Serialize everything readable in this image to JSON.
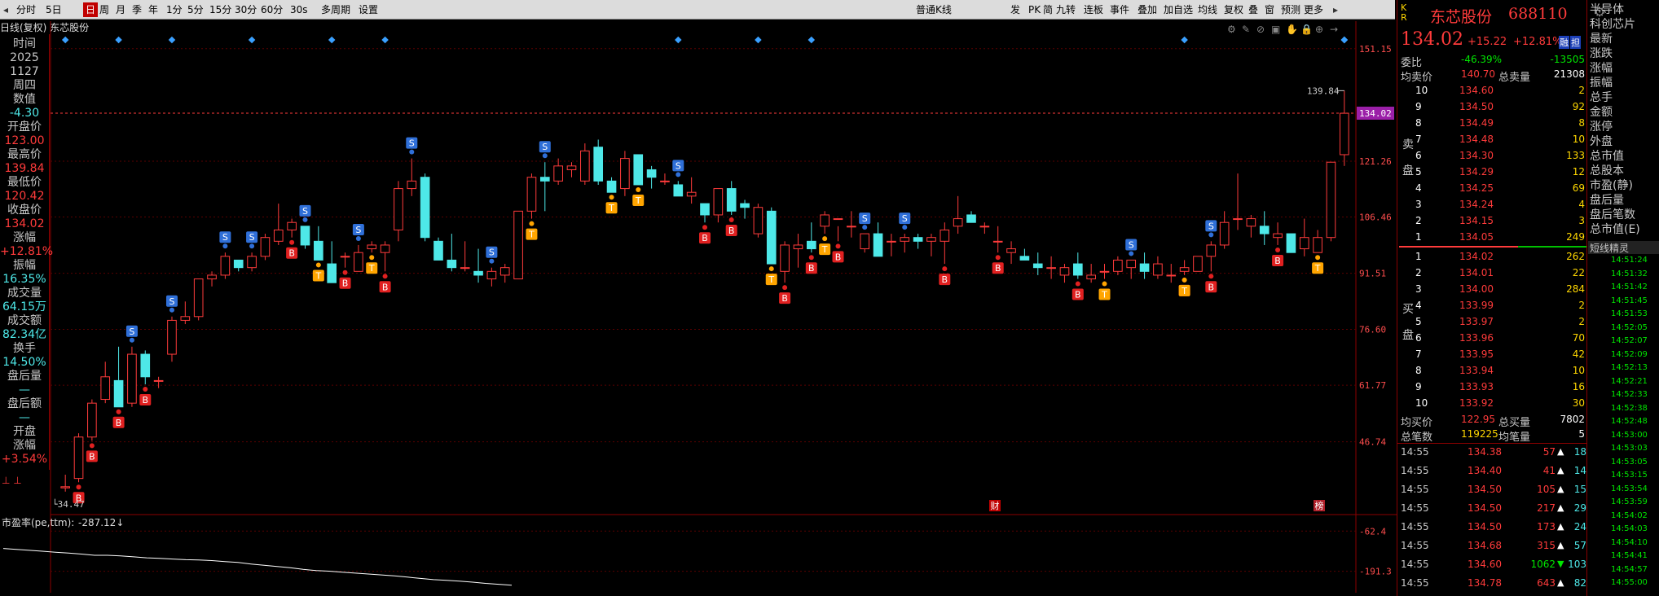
{
  "toolbar": {
    "items": [
      "分时",
      "5日",
      "日",
      "周",
      "月",
      "季",
      "年",
      "1分",
      "5分",
      "15分",
      "30分",
      "60分",
      "30s",
      "多周期",
      "设置"
    ],
    "selected": "日",
    "right_items": [
      "普通K线",
      "发",
      "PK",
      "简",
      "九转",
      "连板",
      "事件",
      "叠加",
      "加自选",
      "均线",
      "复权",
      "叠",
      "窗",
      "预测",
      "更多"
    ]
  },
  "chart_title": "日线(复权)  东芯股份",
  "left_panel": [
    {
      "label": "时间",
      "value": "2025"
    },
    {
      "label": "",
      "value": "1127"
    },
    {
      "label": "周四",
      "value": ""
    },
    {
      "label": "数值",
      "value": "-4.30"
    },
    {
      "label": "开盘价",
      "value": "123.00"
    },
    {
      "label": "最高价",
      "value": "139.84"
    },
    {
      "label": "最低价",
      "value": "120.42"
    },
    {
      "label": "收盘价",
      "value": "134.02"
    },
    {
      "label": "涨幅",
      "value": "+12.81%"
    },
    {
      "label": "振幅",
      "value": "16.35%"
    },
    {
      "label": "成交量",
      "value": "64.15万"
    },
    {
      "label": "成交额",
      "value": "82.34亿"
    },
    {
      "label": "换手",
      "value": "14.50%"
    },
    {
      "label": "盘后量",
      "value": "—"
    },
    {
      "label": "盘后额",
      "value": "—"
    },
    {
      "label": "开盘",
      "value": ""
    },
    {
      "label": "涨幅",
      "value": "+3.54%"
    }
  ],
  "price_axis": [
    "151.15",
    "134.02",
    "121.26",
    "106.46",
    "91.51",
    "76.60",
    "61.77",
    "46.74"
  ],
  "max_label": "139.84",
  "min_label": "34.47",
  "current_price_tag": "134.02",
  "bottom_markers": [
    "财",
    "榜"
  ],
  "indicator": {
    "name": "市盈率(pe,ttm):",
    "value": "-287.12↓",
    "axis": [
      "-62.4",
      "-191.3"
    ]
  },
  "chart_data": {
    "type": "candlestick",
    "title": "日线(复权) 东芯股份",
    "candles": [
      [
        34.5,
        38,
        33.5,
        34.8
      ],
      [
        37,
        49,
        36,
        48
      ],
      [
        48,
        58,
        47,
        57
      ],
      [
        58,
        68,
        57,
        64
      ],
      [
        63,
        72,
        56,
        56
      ],
      [
        57,
        72,
        56,
        70
      ],
      [
        70,
        71,
        62,
        64
      ],
      [
        63,
        64,
        61,
        63
      ],
      [
        70,
        80,
        68,
        79
      ],
      [
        79,
        84,
        78,
        80
      ],
      [
        80,
        90,
        79,
        90
      ],
      [
        90,
        92,
        88,
        91
      ],
      [
        91,
        97,
        90,
        96
      ],
      [
        95,
        95,
        92,
        93
      ],
      [
        93,
        97,
        92,
        96
      ],
      [
        96,
        102,
        95,
        101
      ],
      [
        100,
        110,
        99,
        103
      ],
      [
        103,
        106,
        101,
        105
      ],
      [
        104,
        104,
        98,
        99
      ],
      [
        100,
        104,
        95,
        95
      ],
      [
        94,
        100,
        89,
        89
      ],
      [
        96,
        97,
        93,
        96
      ],
      [
        92,
        99,
        92,
        97
      ],
      [
        98,
        100,
        97,
        99
      ],
      [
        97,
        100,
        92,
        99
      ],
      [
        103,
        116,
        100,
        114
      ],
      [
        114,
        122,
        112,
        116
      ],
      [
        117,
        118,
        100,
        101
      ],
      [
        100,
        101,
        95,
        95
      ],
      [
        95,
        102,
        92,
        93
      ],
      [
        93,
        100,
        92,
        93
      ],
      [
        92,
        98,
        89,
        91
      ],
      [
        90,
        93,
        88,
        92
      ],
      [
        91,
        94,
        89,
        93
      ],
      [
        90,
        107,
        90,
        108
      ],
      [
        108,
        118,
        106,
        117
      ],
      [
        117,
        121,
        108,
        116
      ],
      [
        116,
        122,
        115,
        120
      ],
      [
        119,
        121,
        117,
        120
      ],
      [
        116,
        126,
        115,
        124
      ],
      [
        125,
        127,
        115,
        116
      ],
      [
        116,
        117,
        113,
        113
      ],
      [
        114,
        124,
        112,
        122
      ],
      [
        123,
        122,
        115,
        115
      ],
      [
        119,
        120,
        114,
        117
      ],
      [
        116,
        118,
        115,
        116
      ],
      [
        115,
        116,
        112,
        112
      ],
      [
        112,
        117,
        110,
        113
      ],
      [
        110,
        109,
        105,
        107
      ],
      [
        107,
        113,
        105,
        114
      ],
      [
        114,
        116,
        107,
        108
      ],
      [
        110,
        111,
        106,
        109
      ],
      [
        102,
        110,
        101,
        109
      ],
      [
        108,
        109,
        94,
        94
      ],
      [
        92,
        100,
        89,
        99
      ],
      [
        98,
        102,
        93,
        99
      ],
      [
        100,
        105,
        97,
        98
      ],
      [
        104,
        108,
        102,
        107
      ],
      [
        106,
        104,
        100,
        106
      ],
      [
        104,
        108,
        101,
        104
      ],
      [
        98,
        102,
        97,
        102
      ],
      [
        102,
        105,
        96,
        96
      ],
      [
        100,
        102,
        96,
        100
      ],
      [
        100,
        102,
        97,
        101
      ],
      [
        101,
        102,
        98,
        100
      ],
      [
        100,
        102,
        96,
        101
      ],
      [
        100,
        105,
        94,
        103
      ],
      [
        104,
        112,
        102,
        106
      ],
      [
        107,
        108,
        105,
        105
      ],
      [
        104,
        105,
        102,
        104
      ],
      [
        100,
        104,
        97,
        100
      ],
      [
        97,
        100,
        94,
        98
      ],
      [
        96,
        98,
        95,
        95
      ],
      [
        94,
        97,
        91,
        93
      ],
      [
        93,
        96,
        90,
        93
      ],
      [
        91,
        94,
        89,
        93
      ],
      [
        94,
        97,
        90,
        91
      ],
      [
        90,
        94,
        89,
        91
      ],
      [
        92,
        94,
        90,
        92
      ],
      [
        92,
        96,
        91,
        95
      ],
      [
        93,
        95,
        90,
        95
      ],
      [
        94,
        97,
        90,
        92
      ],
      [
        91,
        96,
        90,
        94
      ],
      [
        91,
        94,
        89,
        91
      ],
      [
        92,
        95,
        91,
        93
      ],
      [
        92,
        95,
        92,
        96
      ],
      [
        96,
        100,
        92,
        99
      ],
      [
        99,
        108,
        98,
        105
      ],
      [
        106,
        118,
        103,
        106
      ],
      [
        104,
        107,
        101,
        106
      ],
      [
        104,
        108,
        99,
        102
      ],
      [
        101,
        105,
        99,
        102
      ],
      [
        102,
        101,
        97,
        97
      ],
      [
        98,
        106,
        96,
        101
      ],
      [
        97,
        103,
        97,
        101
      ],
      [
        101,
        120,
        100,
        121
      ],
      [
        123,
        140,
        120,
        134
      ]
    ],
    "price_ylim": [
      30.0,
      155.0
    ],
    "indicator_series": [
      -118,
      -121,
      -124,
      -127,
      -130,
      -133,
      -136,
      -140,
      -140,
      -142,
      -145,
      -148,
      -150,
      -152,
      -154,
      -155,
      -157,
      -160,
      -163,
      -168,
      -172,
      -176,
      -180,
      -185,
      -189,
      -191,
      -194,
      -197,
      -200,
      -203,
      -206,
      -210,
      -214,
      -218,
      -220,
      -223,
      -226,
      -230,
      -233,
      -236
    ],
    "indicator_ylim": [
      -260,
      -20
    ]
  },
  "right": {
    "sector_tag": "K\nR",
    "name": "东芯股份",
    "code": "688110",
    "price": "134.02",
    "change": "+15.22",
    "change_pct": "+12.81%",
    "badges": [
      "融",
      "担"
    ],
    "weibi": {
      "label": "委比",
      "pct": "-46.39%",
      "diff": "-13505"
    },
    "avg_sell": {
      "label": "均卖价",
      "value": "140.70",
      "total_label": "总卖量",
      "total": "21308"
    },
    "side_sell": "卖\n\n盘",
    "side_buy": "买\n\n盘",
    "sell": [
      [
        "10",
        "134.60",
        "2"
      ],
      [
        "9",
        "134.50",
        "92"
      ],
      [
        "8",
        "134.49",
        "8"
      ],
      [
        "7",
        "134.48",
        "10"
      ],
      [
        "6",
        "134.30",
        "133"
      ],
      [
        "5",
        "134.29",
        "12"
      ],
      [
        "4",
        "134.25",
        "69"
      ],
      [
        "3",
        "134.24",
        "4"
      ],
      [
        "2",
        "134.15",
        "3"
      ],
      [
        "1",
        "134.05",
        "249"
      ]
    ],
    "buy": [
      [
        "1",
        "134.02",
        "262"
      ],
      [
        "2",
        "134.01",
        "22"
      ],
      [
        "3",
        "134.00",
        "284"
      ],
      [
        "4",
        "133.99",
        "2"
      ],
      [
        "5",
        "133.97",
        "2"
      ],
      [
        "6",
        "133.96",
        "70"
      ],
      [
        "7",
        "133.95",
        "42"
      ],
      [
        "8",
        "133.94",
        "10"
      ],
      [
        "9",
        "133.93",
        "16"
      ],
      [
        "10",
        "133.92",
        "30"
      ]
    ],
    "avg_buy": {
      "label": "均买价",
      "value": "122.95",
      "total_label": "总买量",
      "total": "7802"
    },
    "count": {
      "label": "总笔数",
      "value": "119225",
      "avg_label": "均笔量",
      "avg": "5"
    },
    "ticks": [
      [
        "14:55",
        "134.38",
        "57",
        "up",
        "18"
      ],
      [
        "14:55",
        "134.40",
        "41",
        "up",
        "14"
      ],
      [
        "14:55",
        "134.50",
        "105",
        "up",
        "15"
      ],
      [
        "14:55",
        "134.50",
        "217",
        "up",
        "29"
      ],
      [
        "14:55",
        "134.50",
        "173",
        "up",
        "24"
      ],
      [
        "14:55",
        "134.68",
        "315",
        "up",
        "57"
      ],
      [
        "14:55",
        "134.60",
        "1062",
        "down",
        "103"
      ],
      [
        "14:55",
        "134.78",
        "643",
        "up",
        "82"
      ]
    ],
    "side_list": [
      "半导体",
      "科创芯片",
      "最新",
      "涨跌",
      "涨幅",
      "振幅",
      "总手",
      "金额",
      "涨停",
      "外盘",
      "总市值",
      "总股本",
      "市盈(静)",
      "盘后量",
      "盘后笔数",
      "总市值(E)"
    ],
    "spirit_title": "短线精灵",
    "spirit_times": [
      "14:51:24",
      "14:51:32",
      "14:51:42",
      "14:51:45",
      "14:51:53",
      "14:52:05",
      "14:52:07",
      "14:52:09",
      "14:52:13",
      "14:52:21",
      "14:52:33",
      "14:52:38",
      "14:52:48",
      "14:53:00",
      "14:53:03",
      "14:53:05",
      "14:53:15",
      "14:53:54",
      "14:53:59",
      "14:54:02",
      "14:54:03",
      "14:54:10",
      "14:54:41",
      "14:54:57",
      "14:55:00"
    ]
  }
}
